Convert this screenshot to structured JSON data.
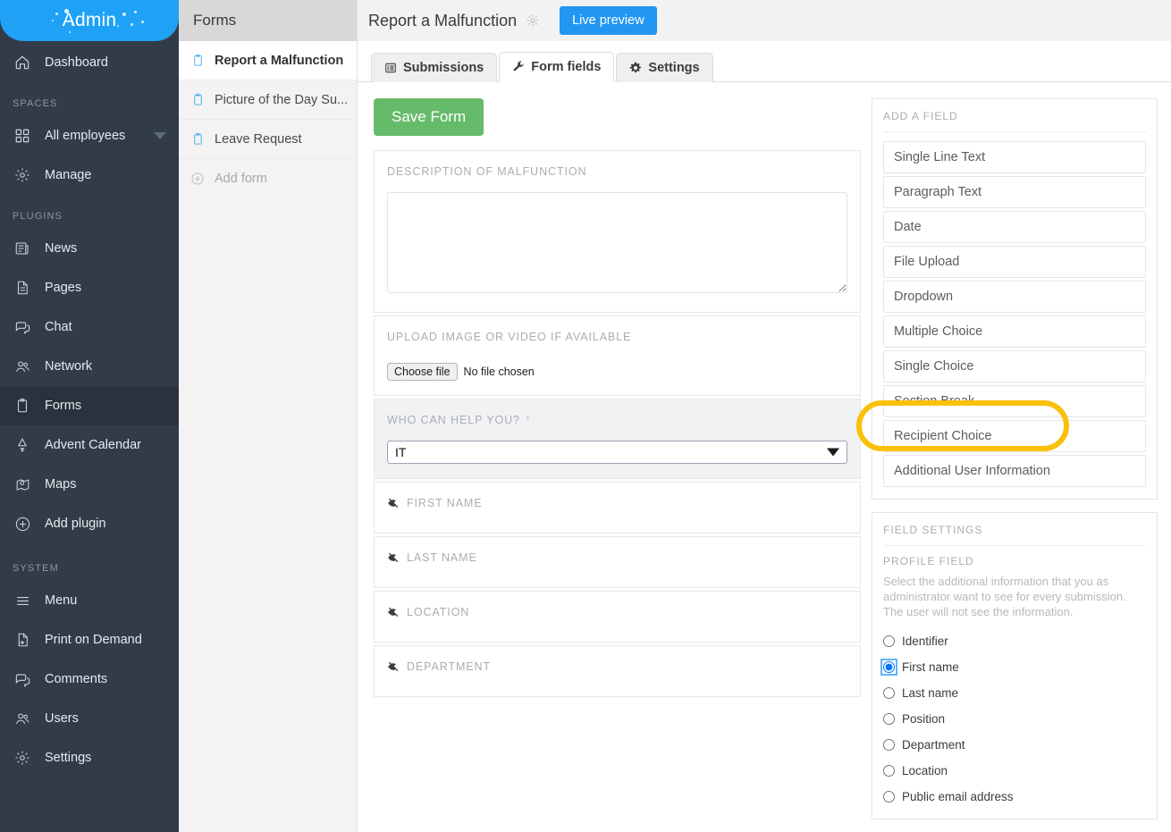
{
  "sidebar": {
    "brand": "Admin",
    "top_items": [
      {
        "label": "Dashboard",
        "icon": "home-icon"
      }
    ],
    "sections": [
      {
        "label": "SPACES",
        "items": [
          {
            "label": "All employees",
            "icon": "grid-icon",
            "caret": true
          },
          {
            "label": "Manage",
            "icon": "gear-icon"
          }
        ]
      },
      {
        "label": "PLUGINS",
        "items": [
          {
            "label": "News",
            "icon": "news-icon"
          },
          {
            "label": "Pages",
            "icon": "page-icon"
          },
          {
            "label": "Chat",
            "icon": "chat-icon"
          },
          {
            "label": "Network",
            "icon": "network-icon"
          },
          {
            "label": "Forms",
            "icon": "clipboard-icon",
            "active": true
          },
          {
            "label": "Advent Calendar",
            "icon": "tree-icon"
          },
          {
            "label": "Maps",
            "icon": "map-pin-icon"
          },
          {
            "label": "Add plugin",
            "icon": "plus-circle-icon"
          }
        ]
      },
      {
        "label": "SYSTEM",
        "items": [
          {
            "label": "Menu",
            "icon": "hamburger-icon"
          },
          {
            "label": "Print on Demand",
            "icon": "print-page-icon"
          },
          {
            "label": "Comments",
            "icon": "comments-icon"
          },
          {
            "label": "Users",
            "icon": "users-icon"
          },
          {
            "label": "Settings",
            "icon": "gear-icon"
          }
        ]
      }
    ]
  },
  "forms_panel": {
    "header": "Forms",
    "items": [
      {
        "label": "Report a Malfunction",
        "selected": true
      },
      {
        "label": "Picture of the Day Su...",
        "selected": false
      },
      {
        "label": "Leave Request",
        "selected": false
      }
    ],
    "add_label": "Add form"
  },
  "header": {
    "title": "Report a Malfunction",
    "settings_icon": "gear-icon",
    "live_preview_label": "Live preview"
  },
  "tabs": [
    {
      "label": "Submissions",
      "icon": "list-icon",
      "active": false
    },
    {
      "label": "Form fields",
      "icon": "wrench-icon",
      "active": true
    },
    {
      "label": "Settings",
      "icon": "gear-icon",
      "active": false
    }
  ],
  "form_editor": {
    "save_label": "Save Form",
    "fields": [
      {
        "type": "textarea",
        "label": "DESCRIPTION OF MALFUNCTION",
        "value": ""
      },
      {
        "type": "file",
        "label": "UPLOAD IMAGE OR VIDEO IF AVAILABLE",
        "button_label": "Choose file",
        "status": "No file chosen"
      },
      {
        "type": "dropdown",
        "label": "WHO CAN HELP YOU?",
        "required_mark": "*",
        "selected": "IT",
        "shaded": true
      },
      {
        "type": "profile",
        "label": "FIRST NAME",
        "icon": "eye-slash-icon"
      },
      {
        "type": "profile",
        "label": "LAST NAME",
        "icon": "eye-slash-icon"
      },
      {
        "type": "profile",
        "label": "LOCATION",
        "icon": "eye-slash-icon"
      },
      {
        "type": "profile",
        "label": "DEPARTMENT",
        "icon": "eye-slash-icon"
      }
    ]
  },
  "add_field_panel": {
    "title": "ADD A FIELD",
    "options": [
      "Single Line Text",
      "Paragraph Text",
      "Date",
      "File Upload",
      "Dropdown",
      "Multiple Choice",
      "Single Choice",
      "Section Break",
      "Recipient Choice",
      "Additional User Information"
    ],
    "highlighted": "Additional User Information",
    "highlight_color": "#fbc009"
  },
  "field_settings": {
    "title": "FIELD SETTINGS",
    "section_label": "PROFILE FIELD",
    "description": "Select the additional information that you as administrator want to see for every submission. The user will not see the information.",
    "options": [
      {
        "label": "Identifier",
        "checked": false
      },
      {
        "label": "First name",
        "checked": true
      },
      {
        "label": "Last name",
        "checked": false
      },
      {
        "label": "Position",
        "checked": false
      },
      {
        "label": "Department",
        "checked": false
      },
      {
        "label": "Location",
        "checked": false
      },
      {
        "label": "Public email address",
        "checked": false
      }
    ]
  },
  "colors": {
    "brand_blue": "#1fa2f5",
    "sidebar_bg": "#323b48",
    "save_green": "#66bb6a",
    "highlight_yellow": "#fbc009",
    "accent_blue": "#2196f3"
  }
}
